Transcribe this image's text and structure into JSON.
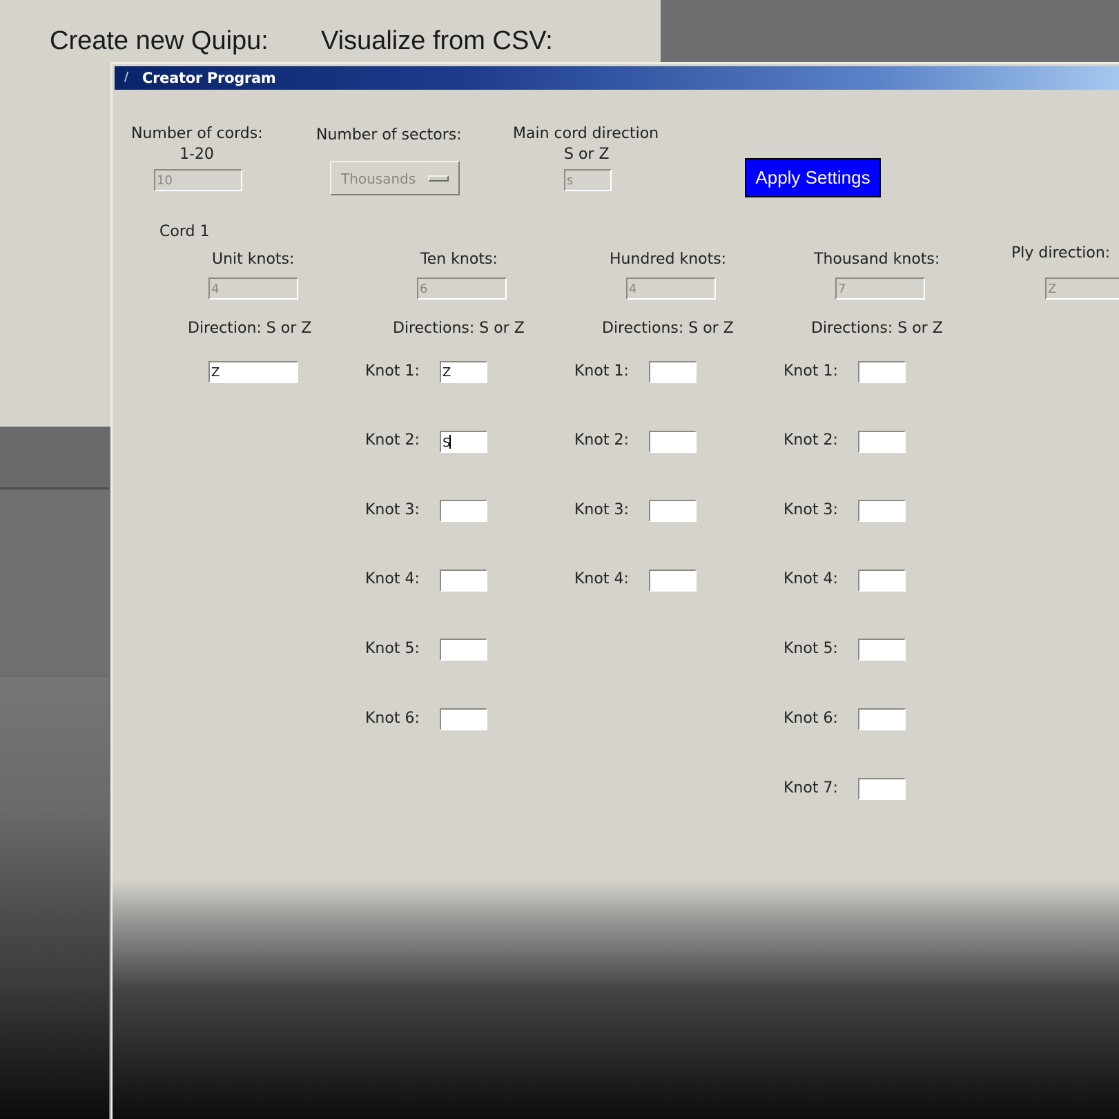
{
  "background_window": {
    "create_label": "Create new Quipu:",
    "visualize_label": "Visualize from CSV:"
  },
  "window": {
    "title": "Creator Program"
  },
  "settings": {
    "cords_label": "Number of cords:",
    "cords_range": "1-20",
    "cords_value": "10",
    "sectors_label": "Number of sectors:",
    "sectors_value": "Thousands",
    "main_dir_label": "Main cord direction",
    "main_dir_hint": "S or Z",
    "main_dir_value": "s",
    "apply_label": "Apply Settings"
  },
  "cord": {
    "title": "Cord 1",
    "unit": {
      "label": "Unit knots:",
      "value": "4",
      "dir_label": "Direction: S or Z",
      "dir_value": "Z"
    },
    "ten": {
      "label": "Ten knots:",
      "value": "6",
      "dir_label": "Directions: S or Z",
      "knots": [
        {
          "label": "Knot 1:",
          "value": "Z"
        },
        {
          "label": "Knot 2:",
          "value": "S"
        },
        {
          "label": "Knot 3:",
          "value": ""
        },
        {
          "label": "Knot 4:",
          "value": ""
        },
        {
          "label": "Knot 5:",
          "value": ""
        },
        {
          "label": "Knot 6:",
          "value": ""
        }
      ]
    },
    "hundred": {
      "label": "Hundred knots:",
      "value": "4",
      "dir_label": "Directions: S or Z",
      "knots": [
        {
          "label": "Knot 1:",
          "value": ""
        },
        {
          "label": "Knot 2:",
          "value": ""
        },
        {
          "label": "Knot 3:",
          "value": ""
        },
        {
          "label": "Knot 4:",
          "value": ""
        }
      ]
    },
    "thousand": {
      "label": "Thousand knots:",
      "value": "7",
      "dir_label": "Directions: S or Z",
      "knots": [
        {
          "label": "Knot 1:",
          "value": ""
        },
        {
          "label": "Knot 2:",
          "value": ""
        },
        {
          "label": "Knot 3:",
          "value": ""
        },
        {
          "label": "Knot 4:",
          "value": ""
        },
        {
          "label": "Knot 5:",
          "value": ""
        },
        {
          "label": "Knot 6:",
          "value": ""
        },
        {
          "label": "Knot 7:",
          "value": ""
        }
      ]
    },
    "ply": {
      "label": "Ply direction:",
      "value": "Z"
    }
  }
}
